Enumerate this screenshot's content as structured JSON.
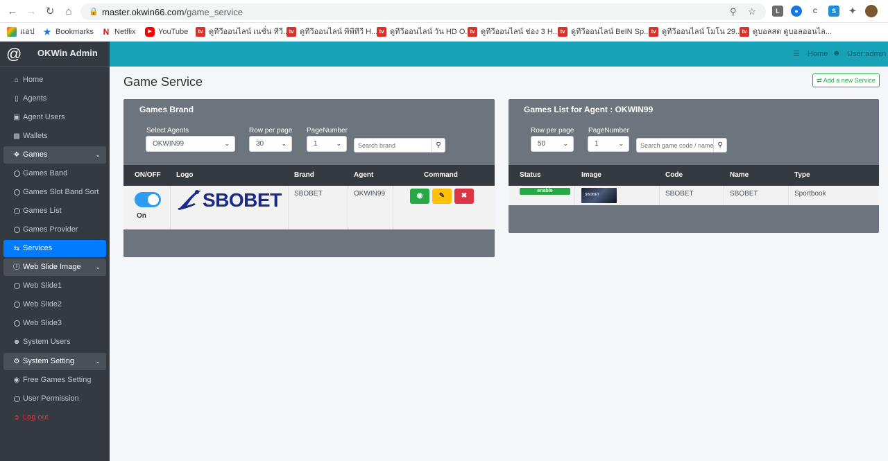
{
  "browser": {
    "url_host": "master.okwin66.com",
    "url_path": "/game_service",
    "bookmarks": [
      {
        "label": "แอป",
        "icon": "apps-grid-icon"
      },
      {
        "label": "Bookmarks",
        "icon": "star-icon"
      },
      {
        "label": "Netflix",
        "icon": "netflix-icon"
      },
      {
        "label": "YouTube",
        "icon": "youtube-icon"
      },
      {
        "label": "ดูทีวีออนไลน์ เนชั่น ทีวี...",
        "icon": "tv-site-icon"
      },
      {
        "label": "ดูทีวีออนไลน์ พีพีทีวี H...",
        "icon": "tv-site-icon"
      },
      {
        "label": "ดูทีวีออนไลน์ วัน HD O...",
        "icon": "tv-site-icon"
      },
      {
        "label": "ดูทีวีออนไลน์ ช่อง 3 H...",
        "icon": "tv-site-icon"
      },
      {
        "label": "ดูทีวีออนไลน์ BeIN Sp...",
        "icon": "tv-site-icon"
      },
      {
        "label": "ดูทีวีออนไลน์ โมโน 29...",
        "icon": "tv-site-icon"
      },
      {
        "label": "ดูบอลสด ดูบอลออนไล...",
        "icon": "tv-site-icon"
      }
    ]
  },
  "sidebar": {
    "brand": "OKWin Admin",
    "items": [
      {
        "label": "Home",
        "icon": "home-icon"
      },
      {
        "label": "Agents",
        "icon": "id-badge-icon"
      },
      {
        "label": "Agent Users",
        "icon": "id-card-icon"
      },
      {
        "label": "Wallets",
        "icon": "wallet-icon"
      },
      {
        "label": "Games",
        "icon": "cubes-icon"
      },
      {
        "label": "Games Band",
        "icon": "circle-icon"
      },
      {
        "label": "Games Slot Band Sort",
        "icon": "circle-icon"
      },
      {
        "label": "Games List",
        "icon": "circle-icon"
      },
      {
        "label": "Games Provider",
        "icon": "circle-icon"
      },
      {
        "label": "Services",
        "icon": "exchange-icon"
      },
      {
        "label": "Web Slide Image",
        "icon": "info-icon"
      },
      {
        "label": "Web Slide1",
        "icon": "circle-icon"
      },
      {
        "label": "Web Slide2",
        "icon": "circle-icon"
      },
      {
        "label": "Web Slide3",
        "icon": "circle-icon"
      },
      {
        "label": "System Users",
        "icon": "user-circle-icon"
      },
      {
        "label": "System Setting",
        "icon": "cogs-icon"
      },
      {
        "label": "Free Games Setting",
        "icon": "gamepad-icon"
      },
      {
        "label": "User Permission",
        "icon": "circle-icon"
      },
      {
        "label": "Log out",
        "icon": "sign-out-icon"
      }
    ]
  },
  "topbar": {
    "home": "Home",
    "user": "User:admin"
  },
  "page": {
    "title": "Game Service",
    "add_button": "Add a new Service"
  },
  "brand_panel": {
    "title": "Games Brand",
    "select_agents_label": "Select Agents",
    "select_agents_value": "OKWIN99",
    "rows_label": "Row per page",
    "rows_value": "30",
    "page_label": "PageNumber",
    "page_value": "1",
    "search_placeholder": "Search brand",
    "columns": [
      "ON/OFF",
      "Logo",
      "Brand",
      "Agent",
      "Command"
    ],
    "row": {
      "status": "On",
      "logo_text": "SBOBET",
      "brand": "SBOBET",
      "agent": "OKWIN99"
    }
  },
  "list_panel": {
    "title": "Games List for Agent : OKWIN99",
    "rows_label": "Row per page",
    "rows_value": "50",
    "page_label": "PageNumber",
    "page_value": "1",
    "search_placeholder": "Search game code / name",
    "columns": [
      "Status",
      "Image",
      "Code",
      "Name",
      "Type"
    ],
    "row": {
      "status": "enable",
      "image_text": "SBOBET",
      "code": "SBOBET",
      "name": "SBOBET",
      "type": "Sportbook"
    }
  },
  "colors": {
    "topbar": "#17a2b8",
    "sidebar": "#343a40",
    "active": "#007bff",
    "panel": "#6c757d",
    "view_button": "#28a745",
    "edit_button": "#ffc107",
    "delete_button": "#dc3545"
  }
}
